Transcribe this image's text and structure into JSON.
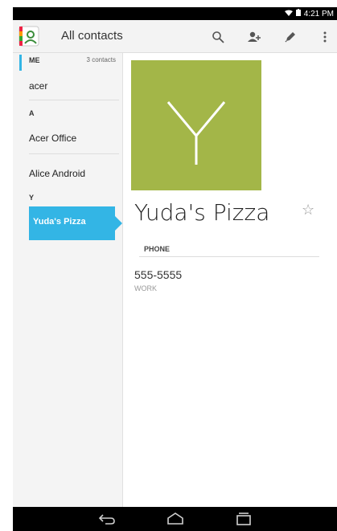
{
  "status_bar": {
    "time": "4:21 PM"
  },
  "action_bar": {
    "title": "All contacts",
    "icons": [
      "contacts-app-icon",
      "search-icon",
      "add-contact-icon",
      "edit-icon",
      "overflow-menu-icon"
    ]
  },
  "sidebar": {
    "me_label": "ME",
    "contacts_count": "3 contacts",
    "me_item": "acer",
    "sections": [
      {
        "letter": "A",
        "items": [
          "Acer Office",
          "Alice Android"
        ]
      },
      {
        "letter": "Y",
        "items": [
          "Yuda's Pizza"
        ]
      }
    ],
    "selected": "Yuda's Pizza"
  },
  "detail": {
    "photo_letter": "Y",
    "name": "Yuda's Pizza",
    "phone_section": "PHONE",
    "phone_number": "555-5555",
    "phone_type": "WORK"
  },
  "colors": {
    "accent": "#33b5e5",
    "photo": "#a3b648"
  }
}
